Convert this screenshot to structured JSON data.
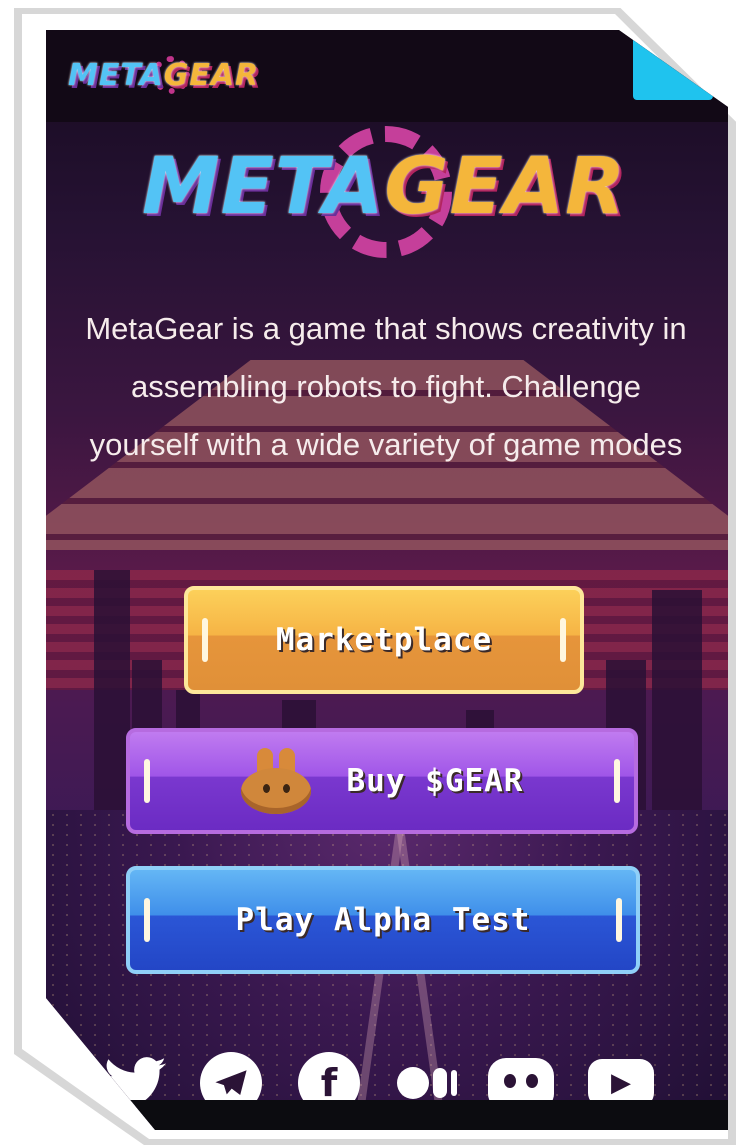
{
  "header": {
    "logo_left": "META",
    "logo_right": "GEAR"
  },
  "hero": {
    "logo_left": "META",
    "logo_right": "GEAR",
    "description": "MetaGear is a game that shows creativity in assembling robots to fight. Challenge yourself with a wide variety of game modes"
  },
  "buttons": {
    "marketplace": "Marketplace",
    "buy": "Buy $GEAR",
    "play": "Play Alpha Test"
  },
  "icons": {
    "menu": "menu-icon",
    "pancakeswap": "pancakeswap-bunny-icon",
    "twitter": "twitter-icon",
    "telegram": "telegram-icon",
    "facebook": "facebook-icon",
    "medium": "medium-icon",
    "discord": "discord-icon",
    "youtube": "youtube-icon"
  },
  "colors": {
    "accent_cyan": "#1fc3ee",
    "marketplace": "#f6b445",
    "buy": "#a056e8",
    "play": "#3f8fea"
  }
}
